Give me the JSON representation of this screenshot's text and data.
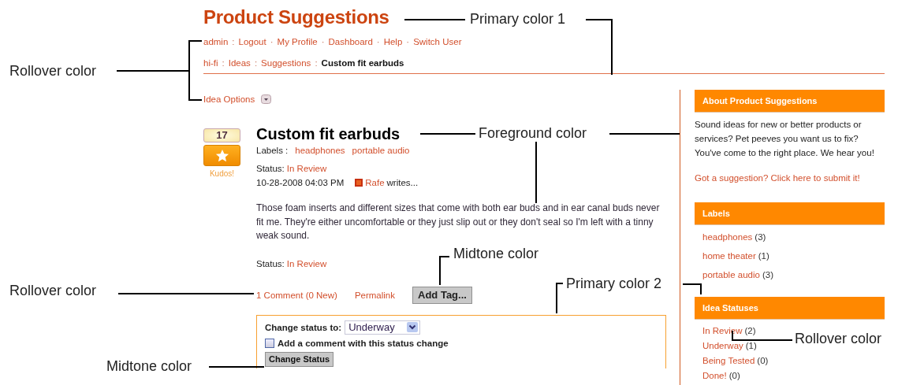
{
  "header": {
    "title": "Product Suggestions",
    "user_menu": [
      {
        "label": "admin",
        "separator": ":"
      },
      {
        "label": "Logout",
        "separator": "·"
      },
      {
        "label": "My Profile",
        "separator": "·"
      },
      {
        "label": "Dashboard",
        "separator": "·"
      },
      {
        "label": "Help",
        "separator": "·"
      },
      {
        "label": "Switch User"
      }
    ],
    "breadcrumb": [
      {
        "label": "hi-fi",
        "separator": ":",
        "current": false
      },
      {
        "label": "Ideas",
        "separator": ":",
        "current": false
      },
      {
        "label": "Suggestions",
        "separator": ":",
        "current": false
      },
      {
        "label": "Custom fit earbuds",
        "current": true
      }
    ]
  },
  "idea_options": {
    "label": "Idea Options"
  },
  "kudos": {
    "count": "17",
    "label": "Kudos!"
  },
  "idea": {
    "title": "Custom fit earbuds",
    "labels_caption": "Labels :",
    "labels": [
      "headphones",
      "portable audio"
    ],
    "status_caption": "Status:",
    "status": "In Review",
    "timestamp": "10-28-2008 04:03 PM",
    "author": "Rafe",
    "author_suffix": "writes...",
    "body": "Those foam inserts and different sizes that come with both ear buds and in ear canal buds never fit me.  They're either uncomfortable or they just slip out or they don't seal so I'm left with a tinny weak sound.",
    "footer_status_caption": "Status:",
    "footer_status": "In Review",
    "comments_link": "1 Comment (0 New)",
    "permalink": "Permalink",
    "add_tag_button": "Add Tag..."
  },
  "status_form": {
    "caption": "Change status to:",
    "value": "Underway",
    "checkbox": {
      "label": "Add a comment with this status change",
      "checked": false
    },
    "button": "Change Status"
  },
  "sidebar": {
    "sections": [
      {
        "kind": "text",
        "title": "About Product Suggestions",
        "text": "Sound ideas for new or better products or services? Pet peeves you want us to fix? You've come to the right place. We hear you!",
        "link": "Got a suggestion? Click here to submit it!"
      },
      {
        "kind": "list",
        "title": "Labels",
        "items": [
          {
            "label": "headphones",
            "count": "(3)"
          },
          {
            "label": "home theater",
            "count": "(1)"
          },
          {
            "label": "portable audio",
            "count": "(3)"
          }
        ]
      },
      {
        "kind": "list",
        "title": "Idea Statuses",
        "items": [
          {
            "label": "In Review",
            "count": "(2)"
          },
          {
            "label": "Underway",
            "count": "(1)"
          },
          {
            "label": "Being Tested",
            "count": "(0)"
          },
          {
            "label": "Done!",
            "count": "(0)"
          }
        ]
      }
    ]
  },
  "annotations": [
    {
      "label": "Primary color 1"
    },
    {
      "label": "Rollover color"
    },
    {
      "label": "Foreground color"
    },
    {
      "label": "Midtone color"
    },
    {
      "label": "Rollover color"
    },
    {
      "label": "Primary color 2"
    },
    {
      "label": "Rollover color"
    },
    {
      "label": "Midtone color"
    }
  ]
}
